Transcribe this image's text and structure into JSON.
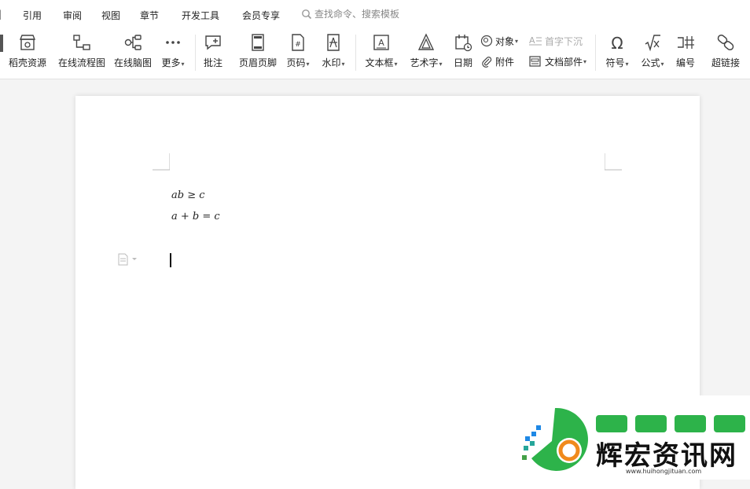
{
  "menubar": {
    "items": [
      {
        "label": "引用",
        "name": "menu-references"
      },
      {
        "label": "审阅",
        "name": "menu-review"
      },
      {
        "label": "视图",
        "name": "menu-view"
      },
      {
        "label": "章节",
        "name": "menu-chapter"
      },
      {
        "label": "开发工具",
        "name": "menu-developer"
      },
      {
        "label": "会员专享",
        "name": "menu-member"
      }
    ],
    "search_placeholder": "查找命令、搜索模板"
  },
  "ribbon": {
    "tools": [
      {
        "label": "稻壳资源",
        "icon": "shop-icon"
      },
      {
        "label": "在线流程图",
        "icon": "flowchart-icon"
      },
      {
        "label": "在线脑图",
        "icon": "mindmap-icon"
      },
      {
        "label": "更多",
        "icon": "more-icon",
        "dropdown": true
      },
      {
        "label": "批注",
        "icon": "comment-icon"
      },
      {
        "label": "页眉页脚",
        "icon": "header-footer-icon"
      },
      {
        "label": "页码",
        "icon": "page-number-icon",
        "dropdown": true
      },
      {
        "label": "水印",
        "icon": "watermark-icon",
        "dropdown": true
      },
      {
        "label": "文本框",
        "icon": "textbox-icon",
        "dropdown": true
      },
      {
        "label": "艺术字",
        "icon": "wordart-icon",
        "dropdown": true
      },
      {
        "label": "日期",
        "icon": "date-icon"
      },
      {
        "label": "符号",
        "icon": "omega-icon",
        "dropdown": true
      },
      {
        "label": "公式",
        "icon": "formula-icon",
        "dropdown": true
      },
      {
        "label": "编号",
        "icon": "numbering-icon"
      },
      {
        "label": "超链接",
        "icon": "hyperlink-icon"
      }
    ],
    "small_tools": {
      "object": "对象",
      "dropcap": "首字下沉",
      "attachment": "附件",
      "doc_parts": "文档部件"
    }
  },
  "document": {
    "equations": [
      "ab ≥ c",
      "a + b = c"
    ]
  },
  "watermark": {
    "brand": "辉宏资讯网",
    "url": "www.huihongjituan.com"
  }
}
